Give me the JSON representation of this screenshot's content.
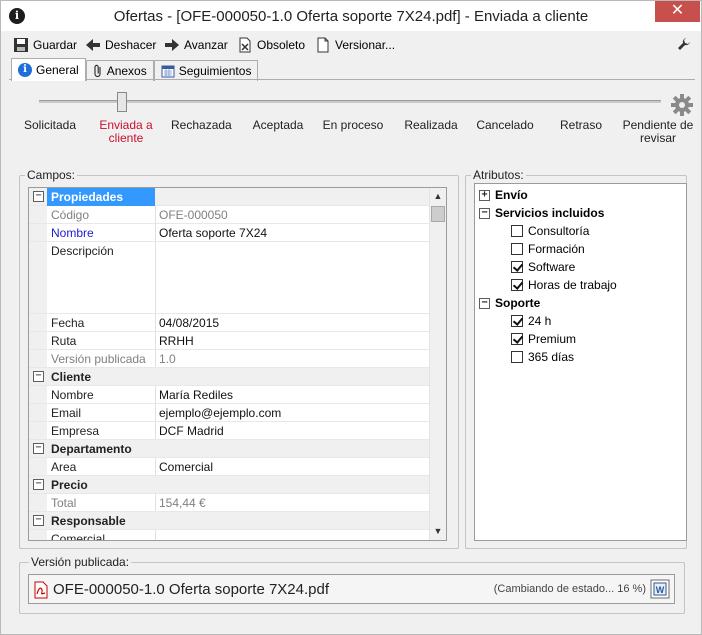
{
  "window": {
    "title": "Ofertas - [OFE-000050-1.0 Oferta soporte 7X24.pdf] - Enviada a cliente",
    "close": "✕"
  },
  "toolbar": {
    "save": "Guardar",
    "undo": "Deshacer",
    "forward": "Avanzar",
    "obsolete": "Obsoleto",
    "version": "Versionar..."
  },
  "tabs": [
    {
      "label": "General",
      "icon": "info-icon",
      "active": true
    },
    {
      "label": "Anexos",
      "icon": "paperclip-icon",
      "active": false
    },
    {
      "label": "Seguimientos",
      "icon": "calendar-icon",
      "active": false
    }
  ],
  "workflow": {
    "stages": [
      "Solicitada",
      "Enviada a cliente",
      "Rechazada",
      "Aceptada",
      "En proceso",
      "Realizada",
      "Cancelado",
      "Retraso",
      "Pendiente de revisar"
    ],
    "current_index": 1,
    "current_color": "#c8102e"
  },
  "fields": {
    "label": "Campos:",
    "rows": [
      {
        "type": "cat",
        "label": "Propiedades",
        "selected": true
      },
      {
        "label": "Código",
        "value": "OFE-000050",
        "style": "gray"
      },
      {
        "label": "Nombre",
        "value": "Oferta soporte 7X24",
        "style": "blue"
      },
      {
        "label": "Descripción",
        "value": "",
        "tall": true
      },
      {
        "label": "Fecha",
        "value": "04/08/2015"
      },
      {
        "label": "Ruta",
        "value": "RRHH"
      },
      {
        "label": "Versión publicada",
        "value": "1.0",
        "style": "gray"
      },
      {
        "type": "cat",
        "label": "Cliente"
      },
      {
        "label": "Nombre",
        "value": "María Rediles"
      },
      {
        "label": "Email",
        "value": "ejemplo@ejemplo.com"
      },
      {
        "label": "Empresa",
        "value": "DCF Madrid"
      },
      {
        "type": "cat",
        "label": "Departamento"
      },
      {
        "label": "Area",
        "value": "Comercial"
      },
      {
        "type": "cat",
        "label": "Precio"
      },
      {
        "label": "Total",
        "value": "154,44 €",
        "style": "gray"
      },
      {
        "type": "cat",
        "label": "Responsable"
      },
      {
        "label": "Comercial",
        "value": ""
      }
    ]
  },
  "attributes": {
    "label": "Atributos:",
    "nodes": [
      {
        "label": "Envío",
        "level": 0,
        "expander": "+"
      },
      {
        "label": "Servicios incluidos",
        "level": 0,
        "expander": "−"
      },
      {
        "label": "Consultoría",
        "level": 1,
        "checked": false
      },
      {
        "label": "Formación",
        "level": 1,
        "checked": false
      },
      {
        "label": "Software",
        "level": 1,
        "checked": true
      },
      {
        "label": "Horas de trabajo",
        "level": 1,
        "checked": true
      },
      {
        "label": "Soporte",
        "level": 0,
        "expander": "−"
      },
      {
        "label": "24 h",
        "level": 1,
        "checked": true
      },
      {
        "label": "Premium",
        "level": 1,
        "checked": true
      },
      {
        "label": "365 días",
        "level": 1,
        "checked": false
      }
    ]
  },
  "published": {
    "label": "Versión publicada:",
    "file": "OFE-000050-1.0 Oferta soporte 7X24.pdf",
    "status": "(Cambiando de estado... 16 %)"
  },
  "colors": {
    "selection": "#3399ff",
    "link_blue": "#1c1cd0",
    "close_red": "#c7504d"
  }
}
